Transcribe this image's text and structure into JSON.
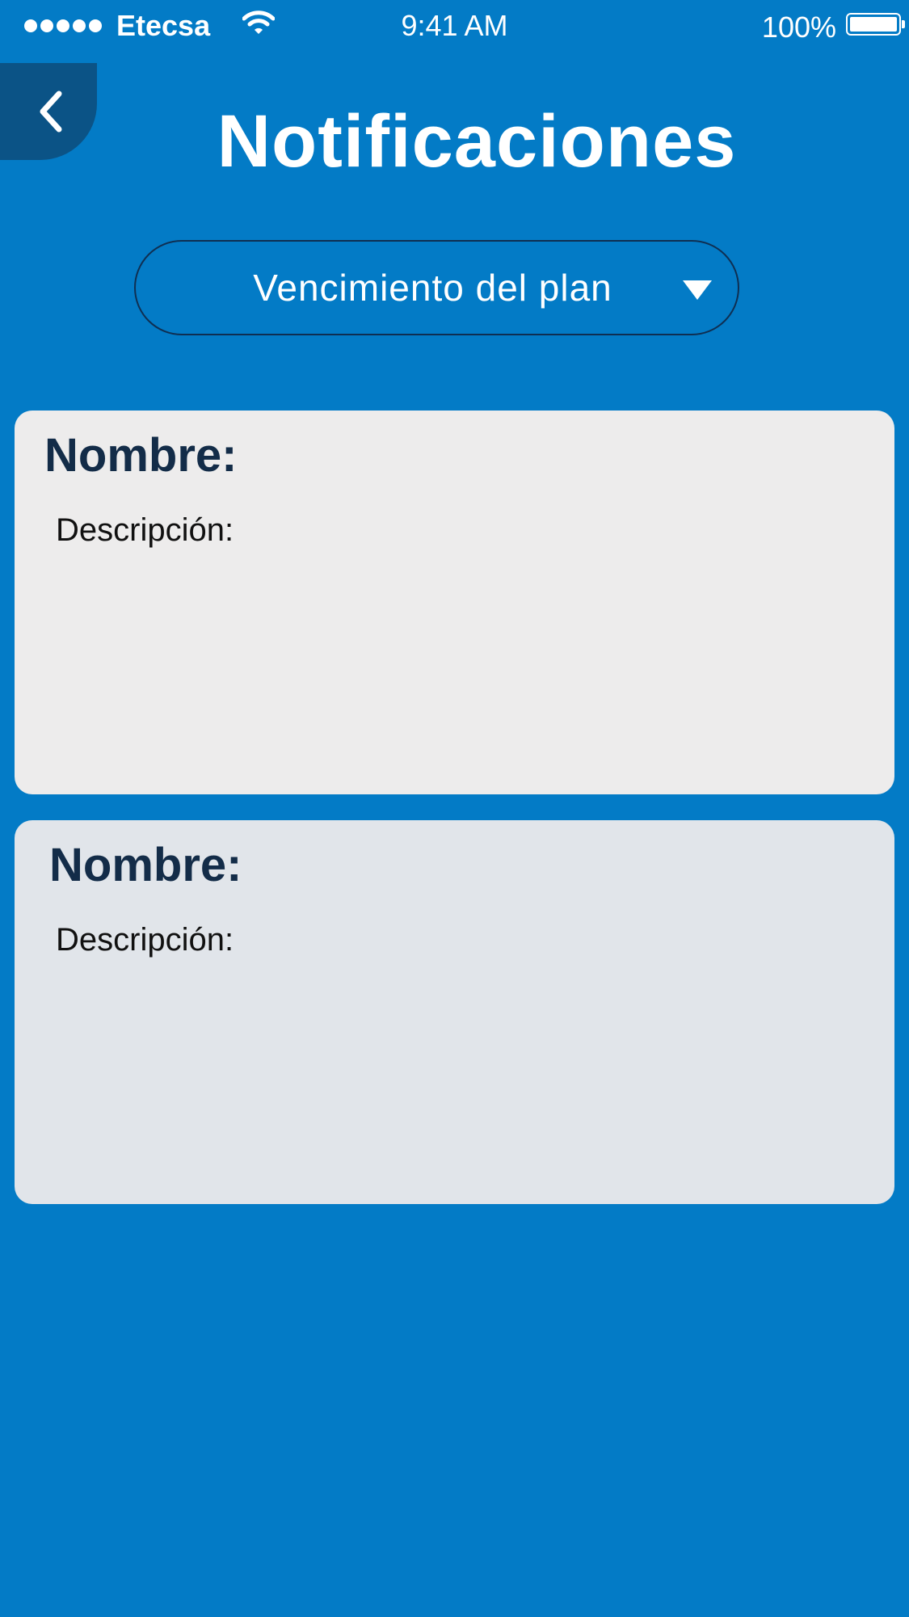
{
  "status_bar": {
    "carrier": "Etecsa",
    "time": "9:41 AM",
    "battery_percent": "100%",
    "signal_icon": "signal-dots-icon",
    "wifi_icon": "wifi-icon",
    "battery_icon": "battery-icon"
  },
  "header": {
    "back_icon": "chevron-left-icon",
    "title": "Notificaciones"
  },
  "filter": {
    "selected": "Vencimiento del plan",
    "arrow_icon": "caret-down-icon"
  },
  "notifications": [
    {
      "name_label": "Nombre:",
      "description_label": "Descripción:"
    },
    {
      "name_label": "Nombre:",
      "description_label": "Descripción:"
    }
  ],
  "colors": {
    "background": "#037bc6",
    "back_button": "#0b5386",
    "card_1": "#edecec",
    "card_2": "#e1e5ea",
    "heading_text": "#132c48"
  }
}
